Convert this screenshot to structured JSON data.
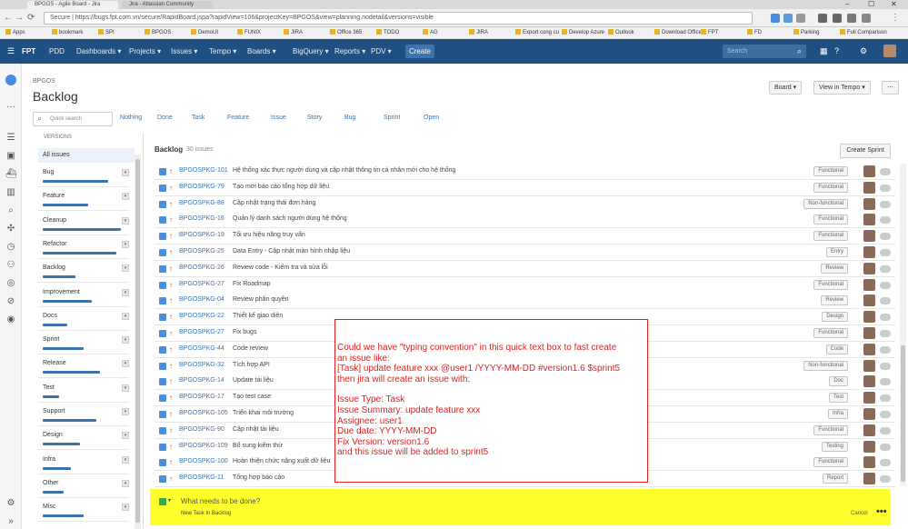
{
  "browser": {
    "tabs": [
      "BPGOS - Agile Board - Jira",
      "Jira - Atlassian Community"
    ],
    "url": "Secure | https://bugs.fpt.com.vn/secure/RapidBoard.jspa?rapidView=106&projectKey=BPGOS&view=planning.nodetail&versions=visible",
    "bookmarks": [
      "Apps",
      "bookmark",
      "SPI",
      "BPGOS",
      "DemoUI",
      "FUNIX",
      "JIRA",
      "Office 365",
      "TODO",
      "AG",
      "JIRA",
      "Export cong cu",
      "Develop Azure",
      "Outlook",
      "Download Office",
      "FPT",
      "FD",
      "Parking",
      "Full Comparison"
    ]
  },
  "jira_nav": {
    "logo": "FPT",
    "items": [
      "PDD",
      "Dashboards ▾",
      "Projects ▾",
      "Issues ▾",
      "Tempo ▾",
      "Boards ▾",
      "BigQuery ▾",
      "Reports ▾",
      "PDV ▾"
    ],
    "create_label": "Create",
    "search_placeholder": "Search"
  },
  "header": {
    "project_key": "BPGOS",
    "title": "Backlog",
    "board_btn": "Board ▾",
    "view_btn": "View in Tempo ▾",
    "more_btn": "⋯"
  },
  "quick_filters": {
    "search_placeholder": "Quick search",
    "items": [
      "Nothing",
      "Done",
      "Task",
      "Feature",
      "Issue",
      "Story",
      "Bug",
      "Sprint",
      "Open"
    ]
  },
  "versions_panel": {
    "heading": "VERSIONS",
    "all_issues": "All issues",
    "items": [
      {
        "name": "Bug",
        "progress": 0.8
      },
      {
        "name": "Feature",
        "progress": 0.55
      },
      {
        "name": "Cleanup",
        "progress": 0.95
      },
      {
        "name": "Refactor",
        "progress": 0.9
      },
      {
        "name": "Backlog",
        "progress": 0.4
      },
      {
        "name": "Improvement",
        "progress": 0.6
      },
      {
        "name": "Docs",
        "progress": 0.3
      },
      {
        "name": "Sprint",
        "progress": 0.5
      },
      {
        "name": "Release",
        "progress": 0.7
      },
      {
        "name": "Test",
        "progress": 0.2
      },
      {
        "name": "Support",
        "progress": 0.65
      },
      {
        "name": "Design",
        "progress": 0.45
      },
      {
        "name": "Infra",
        "progress": 0.35
      },
      {
        "name": "Other",
        "progress": 0.25
      },
      {
        "name": "Misc",
        "progress": 0.5
      }
    ]
  },
  "backlog": {
    "heading": "Backlog",
    "count": "30 issues",
    "create_sprint": "Create Sprint",
    "rows": [
      {
        "key": "BPGOSPKG-101",
        "summary": "Hệ thống xác thực người dùng và cập nhật thông tin cá nhân mới cho hệ thống",
        "label": "Functional"
      },
      {
        "key": "BPGOSPKG-79",
        "summary": "Tạo mới báo cáo tổng hợp dữ liệu",
        "label": "Functional"
      },
      {
        "key": "BPGOSPKG-88",
        "summary": "Cập nhật trạng thái đơn hàng",
        "label": "Non-functional"
      },
      {
        "key": "BPGOSPKG-16",
        "summary": "Quản lý danh sách người dùng hệ thống",
        "label": "Functional"
      },
      {
        "key": "BPGOSPKG-19",
        "summary": "Tối ưu hiệu năng truy vấn",
        "label": "Functional"
      },
      {
        "key": "BPGOSPKG-25",
        "summary": "Data Entry - Cập nhật màn hình nhập liệu",
        "label": "Entry"
      },
      {
        "key": "BPGOSPKG-26",
        "summary": "Review code - Kiểm tra và sửa lỗi",
        "label": "Review"
      },
      {
        "key": "BPGOSPKG-27",
        "summary": "Fix Roadmap",
        "label": "Functional"
      },
      {
        "key": "BPGOSPKG-04",
        "summary": "Review phân quyền",
        "label": "Review"
      },
      {
        "key": "BPGOSPKG-22",
        "summary": "Thiết kế giao diện",
        "label": "Design"
      },
      {
        "key": "BPGOSPKG-27",
        "summary": "Fix bugs",
        "label": "Functional"
      },
      {
        "key": "BPGOSPKG-44",
        "summary": "Code review",
        "label": "Code"
      },
      {
        "key": "BPGOSPKG-32",
        "summary": "Tích hợp API",
        "label": "Non-functional"
      },
      {
        "key": "BPGOSPKG-14",
        "summary": "Update tài liệu",
        "label": "Doc"
      },
      {
        "key": "BPGOSPKG-17",
        "summary": "Tạo test case",
        "label": "Test"
      },
      {
        "key": "BPGOSPKG-105",
        "summary": "Triển khai môi trường",
        "label": "Infra"
      },
      {
        "key": "BPGOSPKG-90",
        "summary": "Cập nhật tài liệu",
        "label": "Functional"
      },
      {
        "key": "BPGOSPKG-109",
        "summary": "Bổ sung kiểm thử",
        "label": "Testing"
      },
      {
        "key": "BPGOSPKG-100",
        "summary": "Hoàn thiện chức năng xuất dữ liệu",
        "label": "Functional"
      },
      {
        "key": "BPGOSPKG-11",
        "summary": "Tổng hợp báo cáo",
        "label": "Report"
      }
    ]
  },
  "annotation": {
    "lines": [
      "Could we have \"typing convention\" in this quick text box to fast create",
      "an issue like:",
      "[Task] update feature xxx @user1 /YYYY-MM-DD #version1.6 $sprint5",
      "then jira will create an issue with:",
      "",
      "Issue Type: Task",
      "Issue Summary: update feature xxx",
      "Assignee: user1",
      "Due date: YYYY-MM-DD",
      "Fix Version: version1.6",
      "and this issue will be added to sprint5"
    ],
    "color": "#e02020"
  },
  "inline_create": {
    "placeholder": "What needs to be done?",
    "hint": "New Task in Backlog",
    "cancel": "Cancel",
    "more": "•••",
    "bg_color": "#ffff2e"
  }
}
